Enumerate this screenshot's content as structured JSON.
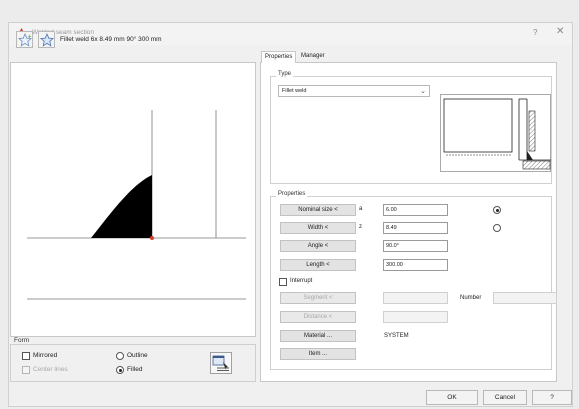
{
  "window": {
    "title": "Welded seam section",
    "help": "?",
    "close": "✕"
  },
  "toolbar": {
    "favorite_add_icon": "star-plus-icon",
    "favorite_list_icon": "star-list-icon",
    "weld_description": "Fillet weld 6x 8.49 mm 90° 300 mm"
  },
  "form": {
    "label": "Form",
    "mirrored": {
      "label": "Mirrored",
      "checked": false
    },
    "center_lines": {
      "label": "Center lines",
      "checked": false,
      "enabled": false
    },
    "outline": {
      "label": "Outline",
      "selected": false
    },
    "filled": {
      "label": "Filled",
      "selected": true
    }
  },
  "tabs": [
    {
      "label": "Properties",
      "active": true
    },
    {
      "label": "Manager",
      "active": false
    }
  ],
  "type": {
    "label": "Type",
    "selected": "Fillet weld"
  },
  "properties": {
    "label": "Properties",
    "nominal_size": {
      "button": "Nominal size <",
      "symbol": "a",
      "value": "6.00",
      "selected": true
    },
    "width": {
      "button": "Width <",
      "symbol": "z",
      "value": "8.49",
      "selected": false
    },
    "angle": {
      "button": "Angle <",
      "value": "90.0°"
    },
    "length": {
      "button": "Length <",
      "value": "300.00"
    },
    "interrupt": {
      "label": "Interrupt",
      "checked": false
    },
    "segment": {
      "button": "Segment <",
      "value": ""
    },
    "distance": {
      "button": "Distance <",
      "value": ""
    },
    "number": {
      "label": "Number",
      "value": ""
    },
    "material": {
      "button": "Material ...",
      "value": "SYSTEM"
    },
    "item": {
      "button": "Item ..."
    }
  },
  "buttons": {
    "ok": "OK",
    "cancel": "Cancel",
    "help": "?"
  },
  "colors": {
    "accent_red": "#d83b2a",
    "weld_fill": "#000000"
  }
}
